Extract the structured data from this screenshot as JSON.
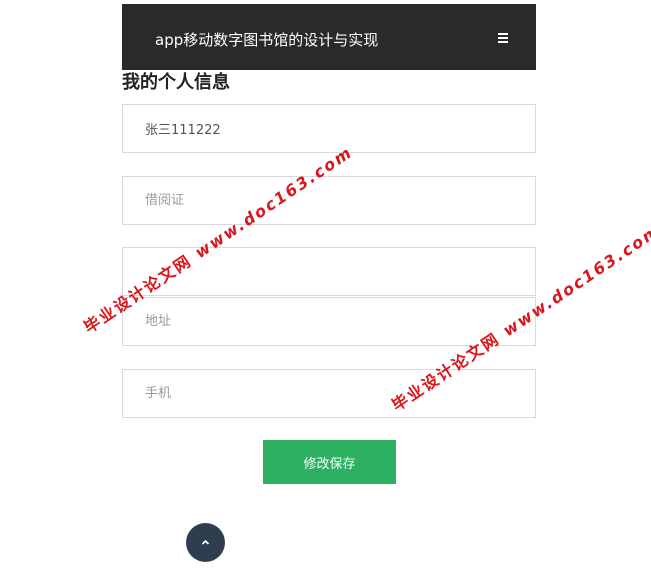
{
  "header": {
    "title": "app移动数字图书馆的设计与实现",
    "menu_icon": "hamburger-menu-icon"
  },
  "page": {
    "title": "我的个人信息"
  },
  "form": {
    "name_value": "张三111222",
    "card_placeholder": "借阅证",
    "field3_placeholder": "",
    "address_placeholder": "地址",
    "phone_placeholder": "手机",
    "save_label": "修改保存"
  },
  "back_to_top": {
    "icon": "chevron-up-icon"
  },
  "watermark": {
    "text_cn": "毕业设计论文网",
    "text_url": "www.doc163.com"
  },
  "colors": {
    "header_bg": "#2a2a2a",
    "primary_green": "#2eb062",
    "back_to_top_bg": "#2f3e4e",
    "watermark_red": "#d9161c"
  }
}
